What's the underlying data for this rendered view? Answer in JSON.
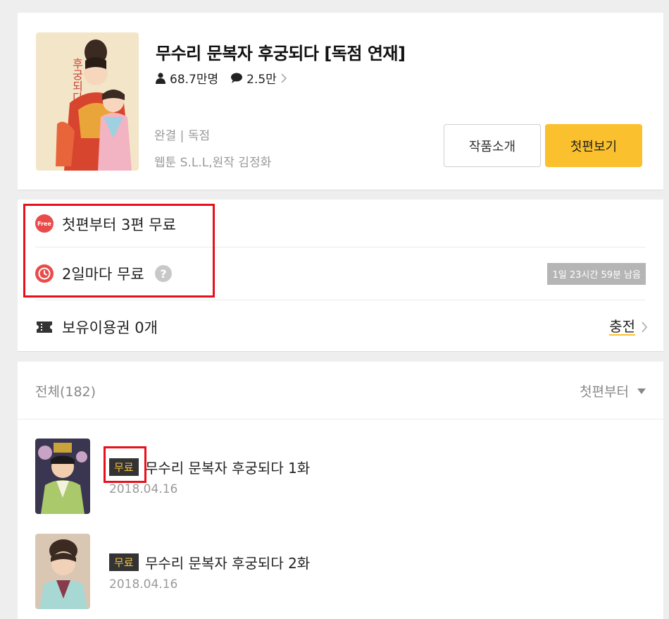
{
  "series": {
    "title": "무수리 문복자 후궁되다 [독점 연재]",
    "readers": "68.7만명",
    "comments": "2.5만",
    "status": "완결 | 독점",
    "authors": "웹툰 S.L.L,원작 김정화",
    "intro_button": "작품소개",
    "first_button": "첫편보기",
    "cover_lettering": "후궁되다"
  },
  "info": {
    "free_icon_label": "Free",
    "free_text": "첫편부터 3편 무료",
    "wait_text": "2일마다 무료",
    "help_label": "?",
    "timer": "1일 23시간 59분 남음",
    "ticket_text": "보유이용권 0개",
    "charge_label": "충전"
  },
  "list": {
    "total": "전체(182)",
    "sort": "첫편부터",
    "episodes": [
      {
        "badge": "무료",
        "title": "무수리 문복자 후궁되다 1화",
        "date": "2018.04.16"
      },
      {
        "badge": "무료",
        "title": "무수리 문복자 후궁되다 2화",
        "date": "2018.04.16"
      }
    ]
  },
  "colors": {
    "accent_yellow": "#fbc02d",
    "free_red": "#e94b4b",
    "highlight_box": "#e8101a",
    "badge_bg": "#333333",
    "badge_text": "#f6c343"
  },
  "icons": [
    "person-icon",
    "speech-bubble-icon",
    "chevron-right-icon",
    "free-icon",
    "clock-icon",
    "help-icon",
    "ticket-icon",
    "caret-down-icon"
  ]
}
